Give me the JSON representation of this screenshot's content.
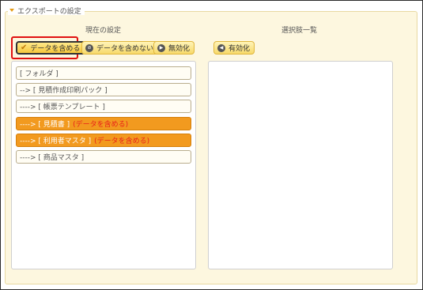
{
  "panel": {
    "legend": "エクスポートの設定"
  },
  "current": {
    "title": "現在の設定",
    "buttons": {
      "include": "データを含める",
      "exclude": "データを含めない",
      "disable": "無効化"
    },
    "items": [
      {
        "label": "[ フォルダ ]",
        "tag": "",
        "highlighted": false
      },
      {
        "label": "--> [ 見積作成印刷パック ]",
        "tag": "",
        "highlighted": false
      },
      {
        "label": "----> [ 帳票テンプレート ]",
        "tag": "",
        "highlighted": false
      },
      {
        "label": "----> [ 見積書 ]",
        "tag": "(データを含める)",
        "highlighted": true
      },
      {
        "label": "----> [ 利用者マスタ ]",
        "tag": "(データを含める)",
        "highlighted": true
      },
      {
        "label": "----> [ 商品マスタ ]",
        "tag": "",
        "highlighted": false
      }
    ]
  },
  "available": {
    "title": "選択肢一覧",
    "buttons": {
      "enable": "有効化"
    }
  },
  "colors": {
    "accent": "#f29a1f",
    "tag": "#e8211a",
    "selection_outline": "#e01010"
  }
}
